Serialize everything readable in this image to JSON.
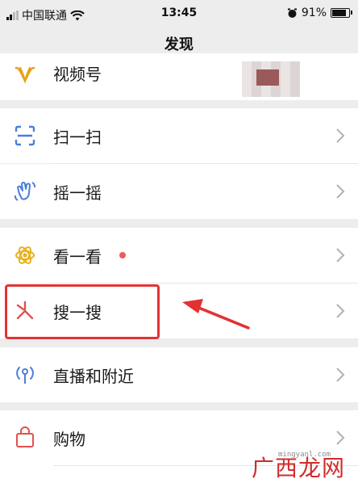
{
  "status_bar": {
    "carrier": "中国联通",
    "time": "13:45",
    "battery": "91%",
    "battery_level": 0.91
  },
  "header": {
    "title": "发现"
  },
  "sections": [
    {
      "label": "视频号"
    },
    {
      "label": "扫一扫"
    },
    {
      "label": "摇一摇"
    },
    {
      "label": "看一看",
      "badge_color": "#f05a5a"
    },
    {
      "label": "搜一搜"
    },
    {
      "label": "直播和附近"
    },
    {
      "label": "购物"
    }
  ],
  "watermark": {
    "small": "mingyanl.com",
    "big": "广西龙网"
  },
  "colors": {
    "annotation": "#e33232",
    "background": "#ededed",
    "row_bg": "#ffffff"
  }
}
